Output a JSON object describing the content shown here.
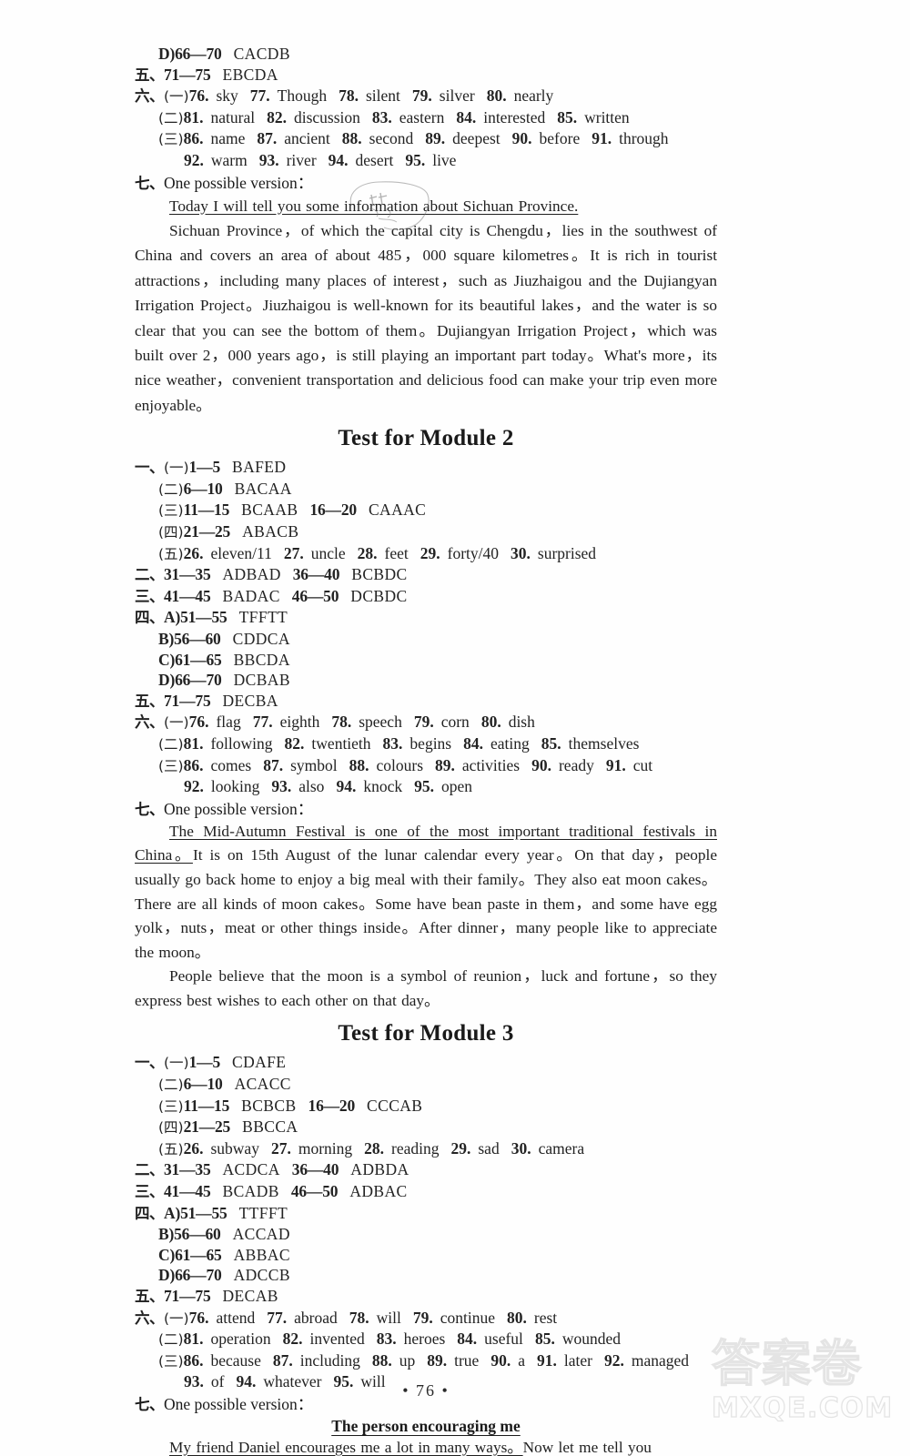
{
  "page": {
    "page_number": "76",
    "footer_left_dot": "•",
    "footer_right_dot": "•"
  },
  "watermark": {
    "chinese": "答案卷",
    "domain": "MXQE.COM"
  },
  "module1_tail": {
    "lines": [
      {
        "indent": 1,
        "prefix": "D)",
        "range": "66—70",
        "answer": "CACDB"
      },
      {
        "indent": 0,
        "prefix_cn": "五、",
        "range": "71—75",
        "answer": "EBCDA"
      }
    ],
    "section6": {
      "cn": "六、",
      "sub1": "(一)",
      "sub1_items": [
        {
          "n": "76.",
          "w": "sky"
        },
        {
          "n": "77.",
          "w": "Though"
        },
        {
          "n": "78.",
          "w": "silent"
        },
        {
          "n": "79.",
          "w": "silver"
        },
        {
          "n": "80.",
          "w": "nearly"
        }
      ],
      "sub2": "(二)",
      "sub2_items": [
        {
          "n": "81.",
          "w": "natural"
        },
        {
          "n": "82.",
          "w": "discussion"
        },
        {
          "n": "83.",
          "w": "eastern"
        },
        {
          "n": "84.",
          "w": "interested"
        },
        {
          "n": "85.",
          "w": "written"
        }
      ],
      "sub3": "(三)",
      "sub3_items": [
        {
          "n": "86.",
          "w": "name"
        },
        {
          "n": "87.",
          "w": "ancient"
        },
        {
          "n": "88.",
          "w": "second"
        },
        {
          "n": "89.",
          "w": "deepest"
        },
        {
          "n": "90.",
          "w": "before"
        },
        {
          "n": "91.",
          "w": "through"
        }
      ],
      "sub3_cont": [
        {
          "n": "92.",
          "w": "warm"
        },
        {
          "n": "93.",
          "w": "river"
        },
        {
          "n": "94.",
          "w": "desert"
        },
        {
          "n": "95.",
          "w": "live"
        }
      ]
    },
    "section7": {
      "cn": "七、",
      "label": "One possible version：",
      "topic_sentence": "Today I will tell you some information about Sichuan Province.",
      "body": "Sichuan Province，of which the capital city is Chengdu，lies in the southwest of China and covers an area of about 485，000 square kilometres。It is rich in tourist attractions，including many places of interest，such as Jiuzhaigou and the Dujiangyan Irrigation Project。Jiuzhaigou is well-known for its beautiful lakes，and the water is so clear that you can see the bottom of them。Dujiangyan Irrigation Project，which was built over 2，000 years ago，is still playing an important part today。What's more，its nice weather，convenient transportation and delicious food can make your trip even more enjoyable。"
    }
  },
  "module2": {
    "title": "Test for Module 2",
    "section1": {
      "cn": "一、",
      "rows": [
        {
          "indent": 0,
          "sub": "(一)",
          "range": "1—5",
          "answer": "BAFED"
        },
        {
          "indent": 1,
          "sub": "(二)",
          "range": "6—10",
          "answer": "BACAA"
        },
        {
          "indent": 1,
          "sub": "(三)",
          "range": "11—15",
          "answer": "BCAAB",
          "range2": "16—20",
          "answer2": "CAAAC"
        },
        {
          "indent": 1,
          "sub": "(四)",
          "range": "21—25",
          "answer": "ABACB"
        }
      ],
      "sub5": "(五)",
      "sub5_items": [
        {
          "n": "26.",
          "w": "eleven/11"
        },
        {
          "n": "27.",
          "w": "uncle"
        },
        {
          "n": "28.",
          "w": "feet"
        },
        {
          "n": "29.",
          "w": "forty/40"
        },
        {
          "n": "30.",
          "w": "surprised"
        }
      ]
    },
    "section2": {
      "cn": "二、",
      "range": "31—35",
      "answer": "ADBAD",
      "range2": "36—40",
      "answer2": "BCBDC"
    },
    "section3": {
      "cn": "三、",
      "range": "41—45",
      "answer": "BADAC",
      "range2": "46—50",
      "answer2": "DCBDC"
    },
    "section4": {
      "cn": "四、",
      "rows": [
        {
          "indent": 0,
          "prefix": "A)",
          "range": "51—55",
          "answer": "TFFTT"
        },
        {
          "indent": 1,
          "prefix": "B)",
          "range": "56—60",
          "answer": "CDDCA"
        },
        {
          "indent": 1,
          "prefix": "C)",
          "range": "61—65",
          "answer": "BBCDA"
        },
        {
          "indent": 1,
          "prefix": "D)",
          "range": "66—70",
          "answer": "DCBAB"
        }
      ]
    },
    "section5": {
      "cn": "五、",
      "range": "71—75",
      "answer": "DECBA"
    },
    "section6": {
      "cn": "六、",
      "sub1": "(一)",
      "sub1_items": [
        {
          "n": "76.",
          "w": "flag"
        },
        {
          "n": "77.",
          "w": "eighth"
        },
        {
          "n": "78.",
          "w": "speech"
        },
        {
          "n": "79.",
          "w": "corn"
        },
        {
          "n": "80.",
          "w": "dish"
        }
      ],
      "sub2": "(二)",
      "sub2_items": [
        {
          "n": "81.",
          "w": "following"
        },
        {
          "n": "82.",
          "w": "twentieth"
        },
        {
          "n": "83.",
          "w": "begins"
        },
        {
          "n": "84.",
          "w": "eating"
        },
        {
          "n": "85.",
          "w": "themselves"
        }
      ],
      "sub3": "(三)",
      "sub3_items": [
        {
          "n": "86.",
          "w": "comes"
        },
        {
          "n": "87.",
          "w": "symbol"
        },
        {
          "n": "88.",
          "w": "colours"
        },
        {
          "n": "89.",
          "w": "activities"
        },
        {
          "n": "90.",
          "w": "ready"
        },
        {
          "n": "91.",
          "w": "cut"
        }
      ],
      "sub3_cont": [
        {
          "n": "92.",
          "w": "looking"
        },
        {
          "n": "93.",
          "w": "also"
        },
        {
          "n": "94.",
          "w": "knock"
        },
        {
          "n": "95.",
          "w": "open"
        }
      ]
    },
    "section7": {
      "cn": "七、",
      "label": "One possible version：",
      "topic_sentence": "The Mid-Autumn Festival is one of the most important traditional festivals in China。",
      "body_rest": "It is on 15th August of the lunar calendar every year。On that day，people usually go back home to enjoy a big meal with their family。They also eat moon cakes。There are all kinds of moon cakes。Some have bean paste in them，and some have egg yolk，nuts，meat or other things inside。After dinner，many people like to appreciate the moon。",
      "para2": "People believe that the moon is a symbol of reunion，luck and fortune，so they express best wishes to each other on that day。"
    }
  },
  "module3": {
    "title": "Test for Module 3",
    "section1": {
      "cn": "一、",
      "rows": [
        {
          "indent": 0,
          "sub": "(一)",
          "range": "1—5",
          "answer": "CDAFE"
        },
        {
          "indent": 1,
          "sub": "(二)",
          "range": "6—10",
          "answer": "ACACC"
        },
        {
          "indent": 1,
          "sub": "(三)",
          "range": "11—15",
          "answer": "BCBCB",
          "range2": "16—20",
          "answer2": "CCCAB"
        },
        {
          "indent": 1,
          "sub": "(四)",
          "range": "21—25",
          "answer": "BBCCA"
        }
      ],
      "sub5": "(五)",
      "sub5_items": [
        {
          "n": "26.",
          "w": "subway"
        },
        {
          "n": "27.",
          "w": "morning"
        },
        {
          "n": "28.",
          "w": "reading"
        },
        {
          "n": "29.",
          "w": "sad"
        },
        {
          "n": "30.",
          "w": "camera"
        }
      ]
    },
    "section2": {
      "cn": "二、",
      "range": "31—35",
      "answer": "ACDCA",
      "range2": "36—40",
      "answer2": "ADBDA"
    },
    "section3": {
      "cn": "三、",
      "range": "41—45",
      "answer": "BCADB",
      "range2": "46—50",
      "answer2": "ADBAC"
    },
    "section4": {
      "cn": "四、",
      "rows": [
        {
          "indent": 0,
          "prefix": "A)",
          "range": "51—55",
          "answer": "TTFFT"
        },
        {
          "indent": 1,
          "prefix": "B)",
          "range": "56—60",
          "answer": "ACCAD"
        },
        {
          "indent": 1,
          "prefix": "C)",
          "range": "61—65",
          "answer": "ABBAC"
        },
        {
          "indent": 1,
          "prefix": "D)",
          "range": "66—70",
          "answer": "ADCCB"
        }
      ]
    },
    "section5": {
      "cn": "五、",
      "range": "71—75",
      "answer": "DECAB"
    },
    "section6": {
      "cn": "六、",
      "sub1": "(一)",
      "sub1_items": [
        {
          "n": "76.",
          "w": "attend"
        },
        {
          "n": "77.",
          "w": "abroad"
        },
        {
          "n": "78.",
          "w": "will"
        },
        {
          "n": "79.",
          "w": "continue"
        },
        {
          "n": "80.",
          "w": "rest"
        }
      ],
      "sub2": "(二)",
      "sub2_items": [
        {
          "n": "81.",
          "w": "operation"
        },
        {
          "n": "82.",
          "w": "invented"
        },
        {
          "n": "83.",
          "w": "heroes"
        },
        {
          "n": "84.",
          "w": "useful"
        },
        {
          "n": "85.",
          "w": "wounded"
        }
      ],
      "sub3": "(三)",
      "sub3_items": [
        {
          "n": "86.",
          "w": "because"
        },
        {
          "n": "87.",
          "w": "including"
        },
        {
          "n": "88.",
          "w": "up"
        },
        {
          "n": "89.",
          "w": "true"
        },
        {
          "n": "90.",
          "w": "a"
        },
        {
          "n": "91.",
          "w": "later"
        },
        {
          "n": "92.",
          "w": "managed"
        }
      ],
      "sub3_cont": [
        {
          "n": "93.",
          "w": "of"
        },
        {
          "n": "94.",
          "w": "whatever"
        },
        {
          "n": "95.",
          "w": "will"
        }
      ]
    },
    "section7": {
      "cn": "七、",
      "label": "One possible version：",
      "essay_title": "The person encouraging me",
      "topic_sentence": "My friend Daniel encourages me a lot in many ways。",
      "body_rest": "Now let me tell you"
    }
  }
}
